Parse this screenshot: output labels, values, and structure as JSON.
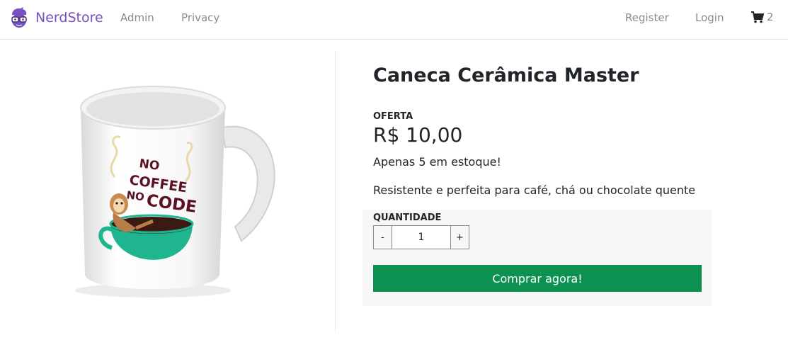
{
  "navbar": {
    "brand_name": "NerdStore",
    "links": {
      "admin": "Admin",
      "privacy": "Privacy",
      "register": "Register",
      "login": "Login"
    },
    "cart_count": "2",
    "cart_icon": "shopping-cart-icon",
    "brand_icon": "nerd-logo-icon"
  },
  "product": {
    "title": "Caneca Cerâmica Master",
    "offer_label": "OFERTA",
    "price": "R$ 10,00",
    "stock": "Apenas 5 em estoque!",
    "description": "Resistente e perfeita para café, chá ou chocolate quente",
    "image_text": [
      "NO",
      "COFFEE",
      "NO",
      "CODE"
    ]
  },
  "purchase": {
    "quantity_label": "QUANTIDADE",
    "decrement_label": "-",
    "increment_label": "+",
    "quantity_value": "1",
    "buy_label": "Comprar agora!"
  },
  "colors": {
    "brand": "#7a4fbf",
    "buy_button": "#0d9150",
    "panel_bg": "#f6f7f6"
  }
}
